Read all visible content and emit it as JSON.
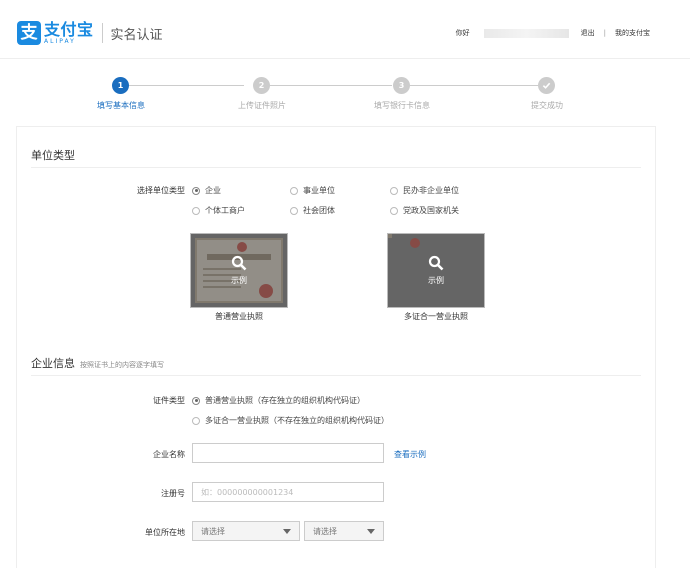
{
  "header": {
    "logo_cn": "支付宝",
    "logo_en": "ALIPAY",
    "logo_mark": "支",
    "page_title": "实名认证",
    "greeting": "你好",
    "logout": "退出",
    "separator": "|",
    "my_alipay": "我的支付宝"
  },
  "steps": [
    {
      "num": "1",
      "label": "填写基本信息",
      "state": "active"
    },
    {
      "num": "2",
      "label": "上传证件照片",
      "state": "pending"
    },
    {
      "num": "3",
      "label": "填写银行卡信息",
      "state": "pending"
    },
    {
      "num": "check-icon",
      "label": "提交成功",
      "state": "pending"
    }
  ],
  "unit_type": {
    "title": "单位类型",
    "label": "选择单位类型",
    "options": [
      {
        "label": "企业",
        "checked": true
      },
      {
        "label": "事业单位",
        "checked": false
      },
      {
        "label": "民办非企业单位",
        "checked": false
      },
      {
        "label": "个体工商户",
        "checked": false
      },
      {
        "label": "社会团体",
        "checked": false
      },
      {
        "label": "党政及国家机关",
        "checked": false
      }
    ],
    "samples": [
      {
        "overlay": "示例",
        "caption": "普通营业执照"
      },
      {
        "overlay": "示例",
        "caption": "多证合一营业执照"
      }
    ]
  },
  "company": {
    "title": "企业信息",
    "subtitle": "按照证书上的内容逐字填写",
    "cert_label": "证件类型",
    "cert_options": [
      {
        "label": "普通营业执照（存在独立的组织机构代码证）",
        "checked": true
      },
      {
        "label": "多证合一营业执照（不存在独立的组织机构代码证）",
        "checked": false
      }
    ],
    "name_label": "企业名称",
    "name_value": "",
    "name_link": "查看示例",
    "reg_label": "注册号",
    "reg_placeholder": "如：000000000001234",
    "location_label": "单位所在地",
    "province_value": "请选择",
    "city_value": "请选择"
  }
}
